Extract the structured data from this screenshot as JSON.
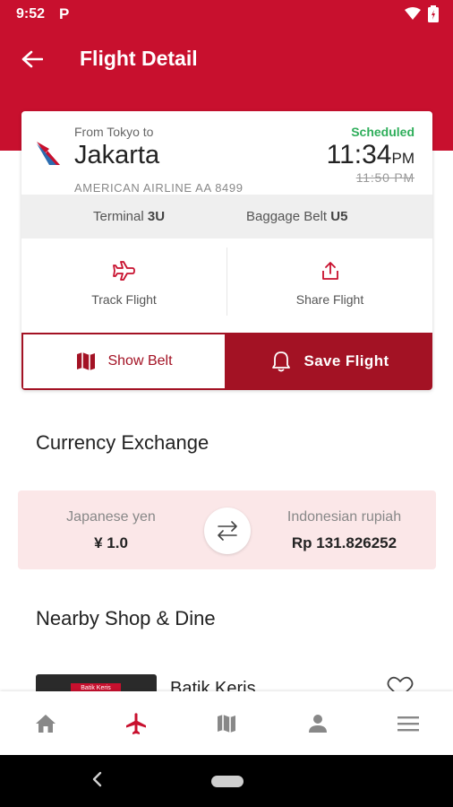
{
  "status_bar": {
    "time": "9:52",
    "app_icon": "P"
  },
  "header": {
    "title": "Flight Detail"
  },
  "flight": {
    "from_text": "From Tokyo to",
    "destination": "Jakarta",
    "airline": "AMERICAN AIRLINE AA 8499",
    "status": "Scheduled",
    "time": "11:34",
    "ampm": "PM",
    "old_time": "11:50 PM",
    "terminal_label": "Terminal",
    "terminal": "3U",
    "belt_label": "Baggage Belt",
    "belt": "U5"
  },
  "actions": {
    "track": "Track Flight",
    "share": "Share Flight",
    "show_belt": "Show Belt",
    "save": "Save Flight"
  },
  "currency": {
    "title": "Currency Exchange",
    "from_name": "Japanese yen",
    "from_value": "¥ 1.0",
    "to_name": "Indonesian rupiah",
    "to_value": "Rp 131.826252"
  },
  "nearby": {
    "title": "Nearby Shop & Dine",
    "items": [
      {
        "name": "Batik Keris",
        "sign": "Batik Keris"
      }
    ]
  },
  "bottom_nav": [
    {
      "name": "home",
      "icon": "home-icon",
      "active": false
    },
    {
      "name": "flights",
      "icon": "airplane-icon",
      "active": true
    },
    {
      "name": "map",
      "icon": "map-icon",
      "active": false
    },
    {
      "name": "profile",
      "icon": "person-icon",
      "active": false
    },
    {
      "name": "menu",
      "icon": "menu-icon",
      "active": false
    }
  ],
  "colors": {
    "brand_red": "#c8102e",
    "dark_red": "#a31224",
    "status_green": "#2fae5b",
    "currency_bg": "#fbe7e8"
  }
}
